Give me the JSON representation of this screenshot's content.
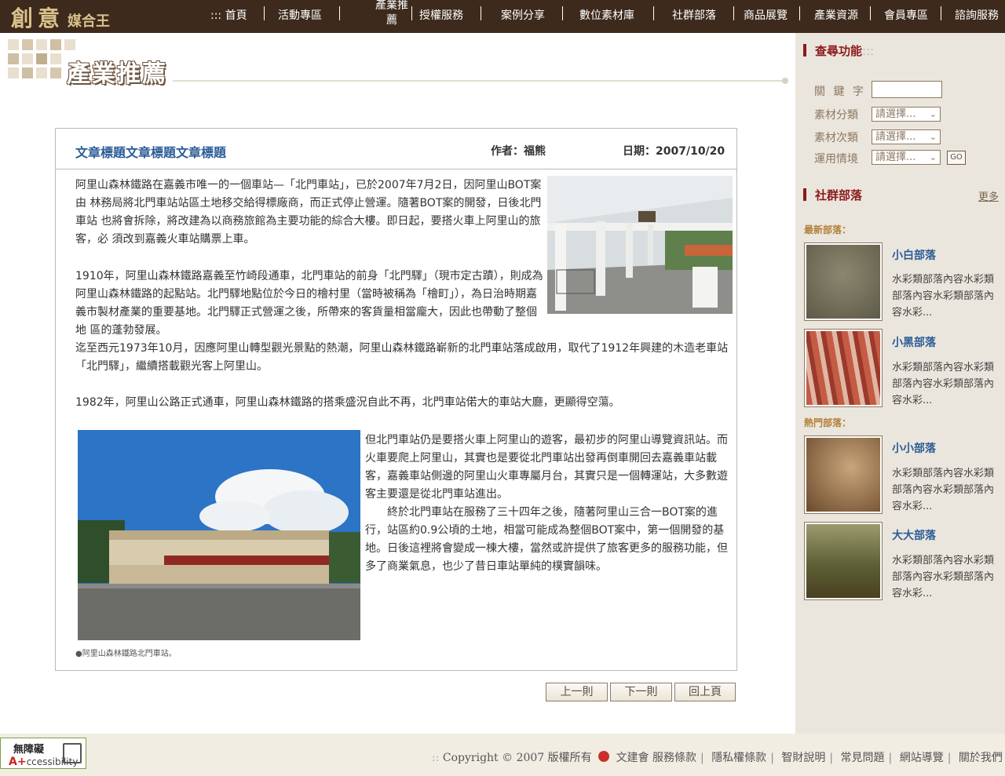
{
  "logo": {
    "text_big": "創意",
    "text_small": "媒合王"
  },
  "nav": {
    "prefix": ":::",
    "items": [
      "首頁",
      "活動專區",
      "產業推薦",
      "授權服務",
      "案例分享",
      "數位素材庫",
      "社群部落",
      "商品展覽",
      "產業資源",
      "會員專區",
      "諮詢服務"
    ],
    "two_line_item": {
      "line1": "產業推",
      "line2": "薦"
    }
  },
  "banner": {
    "title": "產業推薦"
  },
  "article": {
    "title": "文章標題文章標題文章標題",
    "author": "作者：福熊",
    "date": "日期：2007/10/20",
    "p1": "阿里山森林鐵路在嘉義市唯一的一個車站—「北門車站」，已於2007年7月2日，因阿里山BOT案由 林務局將北門車站站區土地移交給得標廠商，而正式停止營運。隨著BOT案的開發，日後北門車站 也將會拆除，將改建為以商務旅館為主要功能的綜合大樓。即日起，要搭火車上阿里山的旅客，必 須改到嘉義火車站購票上車。",
    "p2": "1910年，阿里山森林鐵路嘉義至竹崎段通車，北門車站的前身「北門驛」（現市定古蹟），則成為 阿里山森林鐵路的起點站。北門驛地點位於今日的檜村里（當時被稱為「檜町」），為日治時期嘉 義市製材產業的重要基地。北門驛正式營運之後，所帶來的客貨量相當龐大，因此也帶動了整個地 區的蓬勃發展。",
    "p3": "迄至西元1973年10月，因應阿里山轉型觀光景點的熱潮，阿里山森林鐵路嶄新的北門車站落成啟用，取代了1912年興建的木造老車站「北門驛」，繼續搭載觀光客上阿里山。",
    "p4": "1982年，阿里山公路正式通車，阿里山森林鐵路的搭乘盛況自此不再，北門車站偌大的車站大廳，更顯得空蕩。",
    "p5": "但北門車站仍是要搭火車上阿里山的遊客，最初步的阿里山導覽資訊站。而火車要爬上阿里山，其實也是要從北門車站出發再倒車開回去嘉義車站載客，嘉義車站側邊的阿里山火車專屬月台，其實只是一個轉運站，大多數遊客主要還是從北門車站進出。",
    "p6": "終於北門車站在服務了三十四年之後，隨著阿里山三合一BOT案的進行，站區約0.9公頃的土地，相當可能成為整個BOT案中，第一個開發的基地。日後這裡將會變成一棟大樓，當然或許提供了旅客更多的服務功能，但多了商業氣息，也少了昔日車站單純的樸實韻味。",
    "caption": "●阿里山森林鐵路北門車站。"
  },
  "pager": {
    "prev": "上一則",
    "next": "下一則",
    "back": "回上頁"
  },
  "search": {
    "heading": "查尋功能",
    "heading_suffix": ":::",
    "keyword_label": "關 鍵 字",
    "category_label": "素材分類",
    "subcategory_label": "素材次類",
    "context_label": "運用情境",
    "select_placeholder": "請選擇...",
    "go": "GO"
  },
  "community": {
    "heading": "社群部落",
    "more": "更多",
    "newest_label": "最新部落：",
    "hot_label": "熱門部落：",
    "tribes": [
      {
        "name": "小白部落",
        "desc": "水彩類部落內容水彩類部落內容水彩類部落內容水彩...",
        "color": "#6f6a58"
      },
      {
        "name": "小黑部落",
        "desc": "水彩類部落內容水彩類部落內容水彩類部落內容水彩...",
        "color": "#b5513f"
      },
      {
        "name": "小小部落",
        "desc": "水彩類部落內容水彩類部落內容水彩類部落內容水彩...",
        "color": "#8a6a45"
      },
      {
        "name": "大大部落",
        "desc": "水彩類部落內容水彩類部落內容水彩類部落內容水彩...",
        "color": "#6d6a3f"
      }
    ]
  },
  "footer": {
    "access_title": "無障礙",
    "access_sub_plus": "A+",
    "access_sub": "ccessibility",
    "prefix": "::",
    "copyright": "Copyright © 2007 版權所有",
    "org": "文建會",
    "links": [
      "服務條款",
      "隱私權條款",
      "智財說明",
      "常見問題",
      "網站導覽",
      "關於我們"
    ]
  }
}
